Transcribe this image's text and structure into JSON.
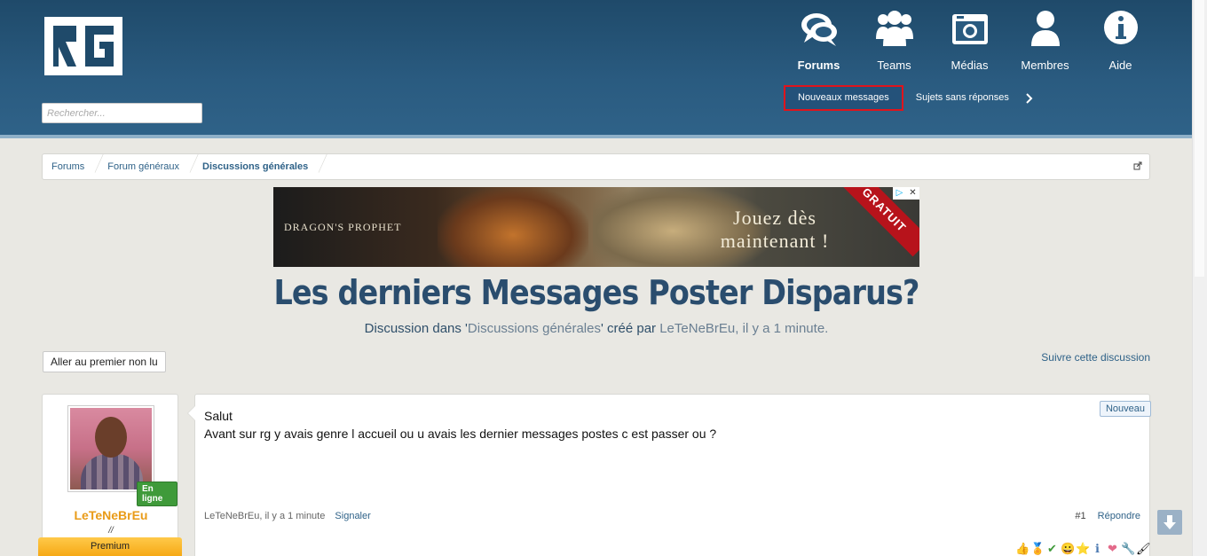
{
  "header": {
    "logo_text": "RG",
    "search_placeholder": "Rechercher...",
    "nav": [
      {
        "label": "Forums",
        "icon": "chat-bubbles-icon",
        "active": true
      },
      {
        "label": "Teams",
        "icon": "users-group-icon",
        "active": false
      },
      {
        "label": "Médias",
        "icon": "camera-icon",
        "active": false
      },
      {
        "label": "Membres",
        "icon": "user-icon",
        "active": false
      },
      {
        "label": "Aide",
        "icon": "info-icon",
        "active": false
      }
    ],
    "subnav": [
      {
        "label": "Nouveaux messages",
        "highlighted": true
      },
      {
        "label": "Sujets sans réponses",
        "highlighted": false
      }
    ]
  },
  "breadcrumb": {
    "items": [
      "Forums",
      "Forum généraux",
      "Discussions générales"
    ]
  },
  "ad": {
    "brand": "DRAGON'S PROPHET",
    "cta_line1": "Jouez dès",
    "cta_line2": "maintenant !",
    "ribbon": "GRATUIT"
  },
  "thread": {
    "title": "Les derniers Messages Poster Disparus?",
    "subtitle_prefix": "Discussion dans '",
    "subtitle_forum": "Discussions générales",
    "subtitle_mid": "' créé par ",
    "subtitle_author": "LeTeNeBrEu",
    "subtitle_suffix": ", il y a 1 minute.",
    "first_unread_label": "Aller au premier non lu",
    "follow_label": "Suivre cette discussion"
  },
  "post": {
    "user": {
      "name": "LeTeNeBrEu",
      "status": "En ligne",
      "title": "//",
      "rank": "Premium",
      "name_color": "#e99b17"
    },
    "lines": [
      "Salut",
      "Avant sur rg y avais genre l accueil ou u avais les dernier messages postes c est passer ou ?"
    ],
    "badge": "Nouveau",
    "meta_author": "LeTeNeBrEu",
    "meta_time": ", il y a 1 minute",
    "report_label": "Signaler",
    "number": "#1",
    "reply_label": "Répondre",
    "reactions": [
      "👍",
      "🏅",
      "✔",
      "😀",
      "⭐",
      "ℹ",
      "❤",
      "🔧",
      "🖌"
    ]
  },
  "colors": {
    "header_bg": "#2a5b80",
    "link": "#2f6288",
    "highlight_border": "#e0141c",
    "online": "#3f9a3a",
    "premium": "#f6a915"
  }
}
